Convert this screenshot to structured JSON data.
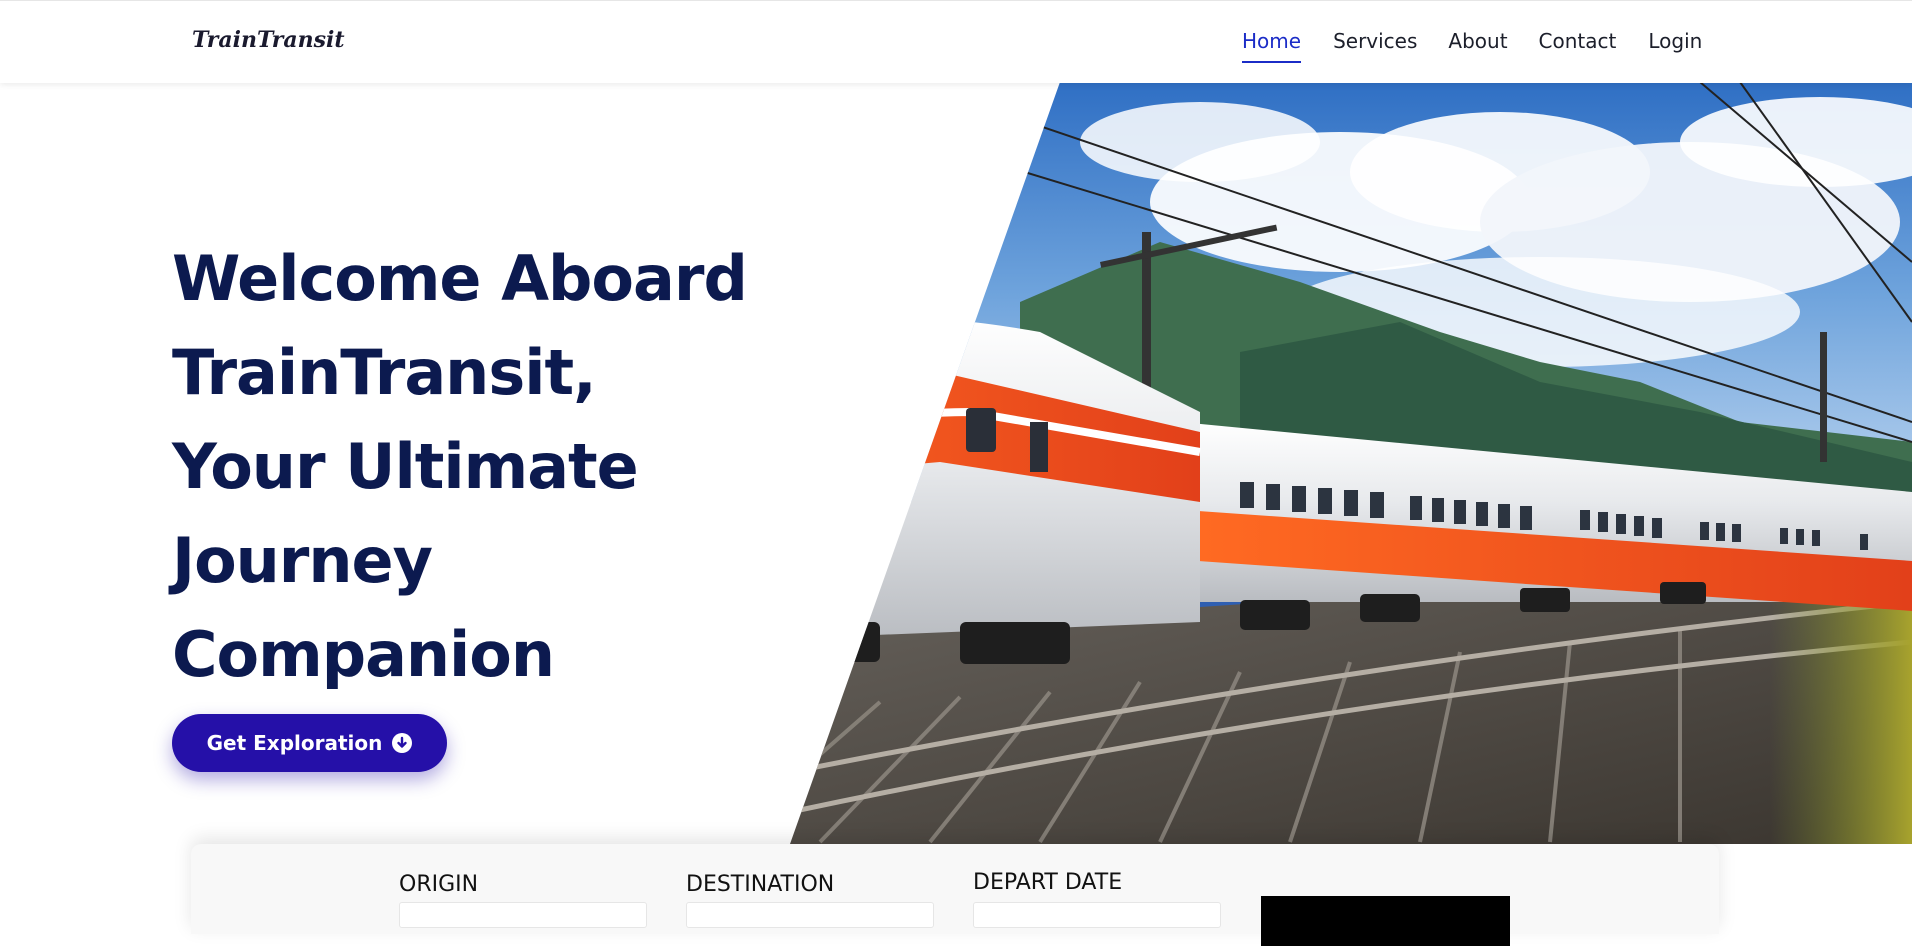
{
  "nav": {
    "brand": "TrainTransit",
    "links": [
      "Home",
      "Services",
      "About",
      "Contact",
      "Login"
    ],
    "active_link": "Home"
  },
  "hero": {
    "title_lines": [
      "Welcome Aboard",
      "TrainTransit,",
      "Your Ultimate",
      "Journey",
      "Companion"
    ],
    "cta_label": "Get Exploration",
    "cta_icon": "arrow-down-circle-icon"
  },
  "booking": {
    "origin_label": "ORIGIN",
    "destination_label": "DESTINATION",
    "depart_label": "DEPART DATE"
  },
  "colors": {
    "nav_active": "#1b2cc7",
    "title": "#0c1a4f",
    "cta_bg": "#2510a8",
    "train_orange": "#f0541c"
  }
}
